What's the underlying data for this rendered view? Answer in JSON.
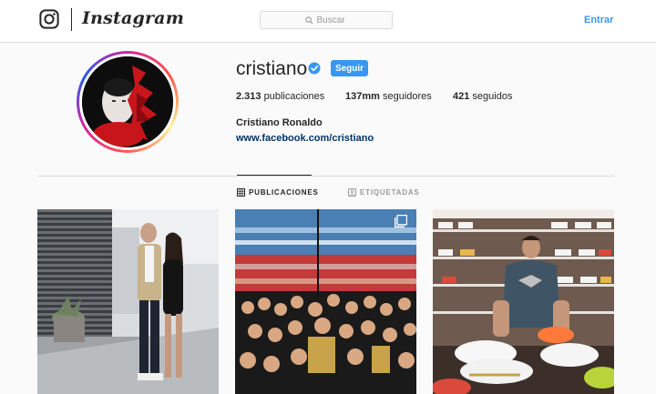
{
  "header": {
    "logo_icon": "instagram-camera-icon",
    "wordmark": "Instagram",
    "search_placeholder": "Buscar",
    "search_icon": "search-icon",
    "login_label": "Entrar"
  },
  "profile": {
    "username": "cristiano",
    "verified_icon": "verified-badge-icon",
    "follow_label": "Seguir",
    "stats": [
      {
        "value": "2.313",
        "label": "publicaciones"
      },
      {
        "value": "137mm",
        "label": "seguidores"
      },
      {
        "value": "421",
        "label": "seguidos"
      }
    ],
    "full_name": "Cristiano Ronaldo",
    "website": "www.facebook.com/cristiano"
  },
  "tabs": [
    {
      "label": "PUBLICACIONES",
      "icon": "grid-icon",
      "active": true
    },
    {
      "label": "ETIQUETADAS",
      "icon": "tag-icon",
      "active": false
    }
  ],
  "posts": [
    {
      "icon": "photo",
      "multi": false
    },
    {
      "icon": "photo",
      "multi": true,
      "multi_icon": "carousel-icon"
    },
    {
      "icon": "photo",
      "multi": false
    }
  ],
  "colors": {
    "accent": "#3897f0",
    "link": "#003569",
    "text": "#262626",
    "muted": "#999999",
    "border": "#dbdbdb",
    "background": "#fafafa"
  }
}
